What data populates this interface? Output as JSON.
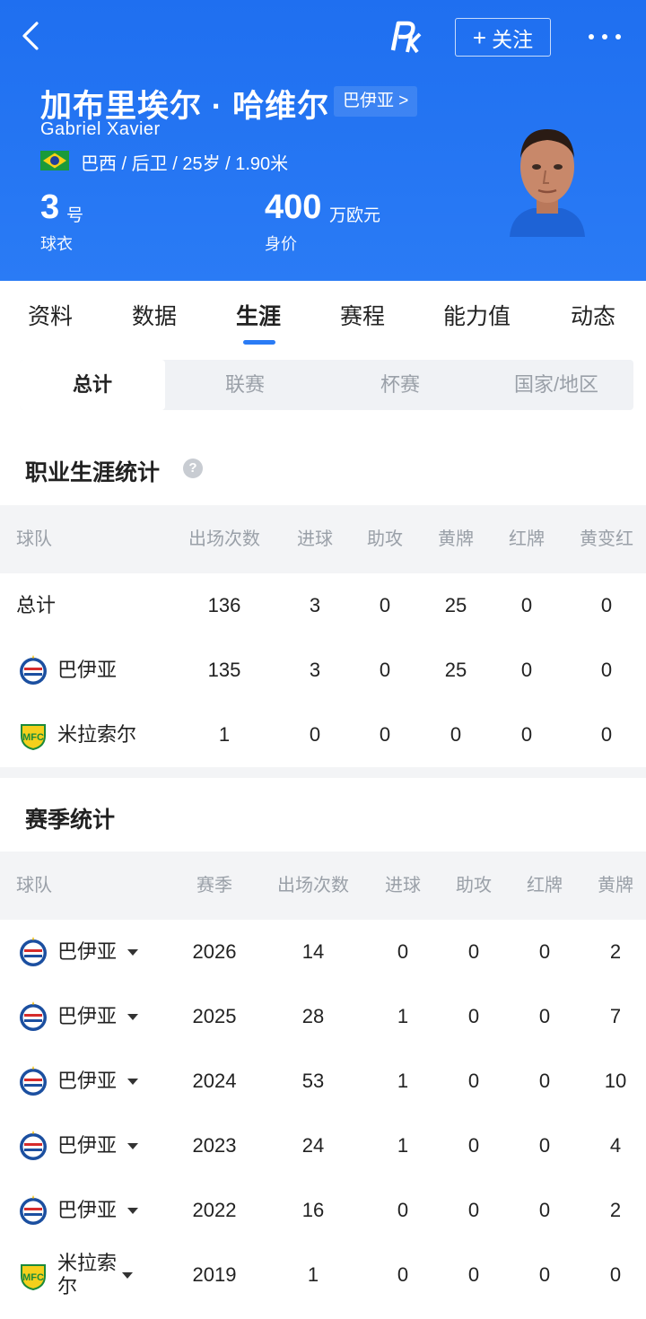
{
  "header": {
    "follow_label": "关注",
    "player_name": "加布里埃尔 · 哈维尔",
    "club_link": "巴伊亚 >",
    "player_name_en": "Gabriel Xavier",
    "info": "巴西 / 后卫 / 25岁 / 1.90米",
    "shirt_number": "3",
    "shirt_unit": "号",
    "shirt_label": "球衣",
    "market_value": "400",
    "market_value_unit": "万欧元",
    "market_value_label": "身价"
  },
  "tabs": [
    "资料",
    "数据",
    "生涯",
    "赛程",
    "能力值",
    "动态"
  ],
  "active_tab": "生涯",
  "subtabs": [
    "总计",
    "联赛",
    "杯赛",
    "国家/地区"
  ],
  "career": {
    "title": "职业生涯统计",
    "columns": [
      "球队",
      "出场次数",
      "进球",
      "助攻",
      "黄牌",
      "红牌",
      "黄变红"
    ],
    "rows": [
      {
        "team": "总计",
        "apps": "136",
        "goals": "3",
        "assists": "0",
        "yellow": "25",
        "red": "0",
        "second_yellow": "0"
      },
      {
        "team": "巴伊亚",
        "apps": "135",
        "goals": "3",
        "assists": "0",
        "yellow": "25",
        "red": "0",
        "second_yellow": "0"
      },
      {
        "team": "米拉索尔",
        "apps": "1",
        "goals": "0",
        "assists": "0",
        "yellow": "0",
        "red": "0",
        "second_yellow": "0"
      }
    ]
  },
  "season": {
    "title": "赛季统计",
    "columns": [
      "球队",
      "赛季",
      "出场次数",
      "进球",
      "助攻",
      "红牌",
      "黄牌"
    ],
    "rows": [
      {
        "team": "巴伊亚",
        "season": "2026",
        "apps": "14",
        "goals": "0",
        "assists": "0",
        "red": "0",
        "yellow": "2"
      },
      {
        "team": "巴伊亚",
        "season": "2025",
        "apps": "28",
        "goals": "1",
        "assists": "0",
        "red": "0",
        "yellow": "7"
      },
      {
        "team": "巴伊亚",
        "season": "2024",
        "apps": "53",
        "goals": "1",
        "assists": "0",
        "red": "0",
        "yellow": "10"
      },
      {
        "team": "巴伊亚",
        "season": "2023",
        "apps": "24",
        "goals": "1",
        "assists": "0",
        "red": "0",
        "yellow": "4"
      },
      {
        "team": "巴伊亚",
        "season": "2022",
        "apps": "16",
        "goals": "0",
        "assists": "0",
        "red": "0",
        "yellow": "2"
      },
      {
        "team": "米拉索尔",
        "season": "2019",
        "apps": "1",
        "goals": "0",
        "assists": "0",
        "red": "0",
        "yellow": "0"
      }
    ]
  },
  "colors": {
    "brand_blue": "#2a7bf5",
    "muted_text": "#9aa0a8"
  }
}
